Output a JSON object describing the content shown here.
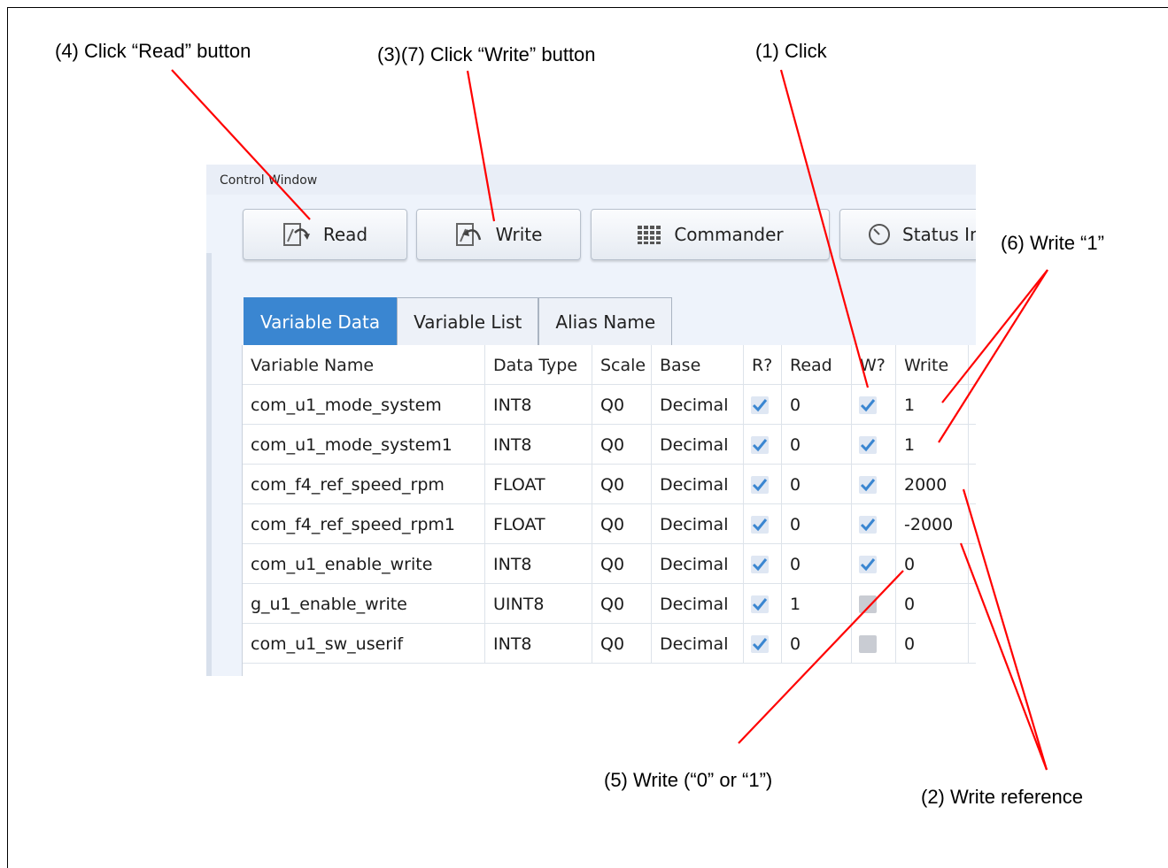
{
  "annotations": {
    "read": "(4) Click “Read” button",
    "write": "(3)(7) Click “Write” button",
    "click": "(1) Click",
    "write_one": "(6) Write “1”",
    "write_zero_one": "(5) Write (“0” or “1”)",
    "write_reference": "(2) Write reference"
  },
  "window": {
    "title": "Control Window"
  },
  "toolbar": {
    "read_label": "Read",
    "write_label": "Write",
    "commander_label": "Commander",
    "status_label": "Status In"
  },
  "icons": {
    "read": "read-icon",
    "write": "write-icon",
    "commander": "grid-icon",
    "status": "timer-icon"
  },
  "tabs": [
    {
      "label": "Variable Data",
      "active": true
    },
    {
      "label": "Variable List",
      "active": false
    },
    {
      "label": "Alias Name",
      "active": false
    }
  ],
  "table": {
    "headers": [
      "Variable Name",
      "Data Type",
      "Scale",
      "Base",
      "R?",
      "Read",
      "W?",
      "Write"
    ],
    "rows": [
      {
        "name": "com_u1_mode_system",
        "type": "INT8",
        "scale": "Q0",
        "base": "Decimal",
        "r": true,
        "read": "0",
        "w": true,
        "write": "1"
      },
      {
        "name": "com_u1_mode_system1",
        "type": "INT8",
        "scale": "Q0",
        "base": "Decimal",
        "r": true,
        "read": "0",
        "w": true,
        "write": "1"
      },
      {
        "name": "com_f4_ref_speed_rpm",
        "type": "FLOAT",
        "scale": "Q0",
        "base": "Decimal",
        "r": true,
        "read": "0",
        "w": true,
        "write": "2000"
      },
      {
        "name": "com_f4_ref_speed_rpm1",
        "type": "FLOAT",
        "scale": "Q0",
        "base": "Decimal",
        "r": true,
        "read": "0",
        "w": true,
        "write": "-2000"
      },
      {
        "name": "com_u1_enable_write",
        "type": "INT8",
        "scale": "Q0",
        "base": "Decimal",
        "r": true,
        "read": "0",
        "w": true,
        "write": "0"
      },
      {
        "name": "g_u1_enable_write",
        "type": "UINT8",
        "scale": "Q0",
        "base": "Decimal",
        "r": true,
        "read": "1",
        "w": false,
        "write": "0"
      },
      {
        "name": "com_u1_sw_userif",
        "type": "INT8",
        "scale": "Q0",
        "base": "Decimal",
        "r": true,
        "read": "0",
        "w": false,
        "write": "0"
      }
    ]
  },
  "colors": {
    "annotation_line": "#ff0000",
    "active_tab": "#3a86d1",
    "check": "#3a86d1"
  }
}
